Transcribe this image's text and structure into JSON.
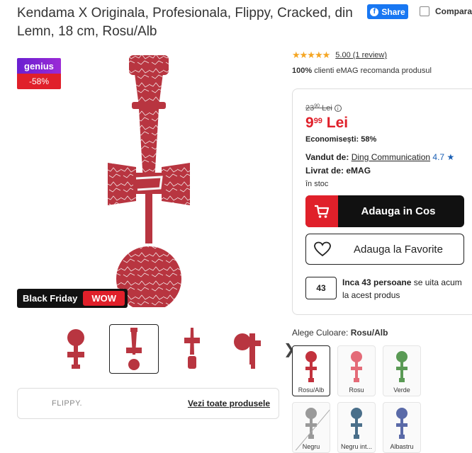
{
  "product": {
    "title": "Kendama X Originala, Profesionala, Flippy, Cracked, din Lemn, 18 cm, Rosu/Alb"
  },
  "header": {
    "share_label": "Share",
    "compare_label": "Compara"
  },
  "badges": {
    "genius": "genius",
    "discount": "-58%",
    "black_friday": "Black Friday",
    "wow": "WOW"
  },
  "rating": {
    "stars": "★★★★★",
    "text": "5.00 (1 review)",
    "recommend_percent": "100%",
    "recommend_text": " clienti eMAG recomanda produsul"
  },
  "pricing": {
    "old_price": "23⁰⁰ Lei",
    "old_price_int": "23",
    "old_price_dec": "90",
    "old_price_currency": "Lei",
    "price_int": "9",
    "price_dec": "99",
    "currency": "Lei",
    "economy": "Economisești: 58%"
  },
  "seller": {
    "sold_by_label": "Vandut de:",
    "seller_name": "Ding Communication",
    "seller_rating": "4.7",
    "delivered_label": "Livrat de:",
    "delivered_by": "eMAG",
    "stock": "în stoc"
  },
  "actions": {
    "add_to_cart": "Adauga in Cos",
    "add_to_favorites": "Adauga la Favorite"
  },
  "viewers": {
    "count": "43",
    "bold_text": "Inca 43 persoane",
    "rest_text": " se uita acum la acest produs"
  },
  "colors": {
    "label": "Alege Culoare:",
    "selected": "Rosu/Alb",
    "options": [
      {
        "name": "Rosu/Alb",
        "color": "#c2323d"
      },
      {
        "name": "Rosu",
        "color": "#e46b78"
      },
      {
        "name": "Verde",
        "color": "#5a9a55"
      },
      {
        "name": "Negru",
        "color": "#9a9a9a"
      },
      {
        "name": "Negru int...",
        "color": "#4a6f8a"
      },
      {
        "name": "Albastru",
        "color": "#5a6aa8"
      }
    ]
  },
  "brand": {
    "logo": "FLIPPY.",
    "link": "Vezi toate produsele"
  },
  "theme": {
    "accent": "#e0202a",
    "genius_purple": "#6a1fd1",
    "share_blue": "#1877f2",
    "star": "#f5a623",
    "kendama_red": "#b83540"
  }
}
